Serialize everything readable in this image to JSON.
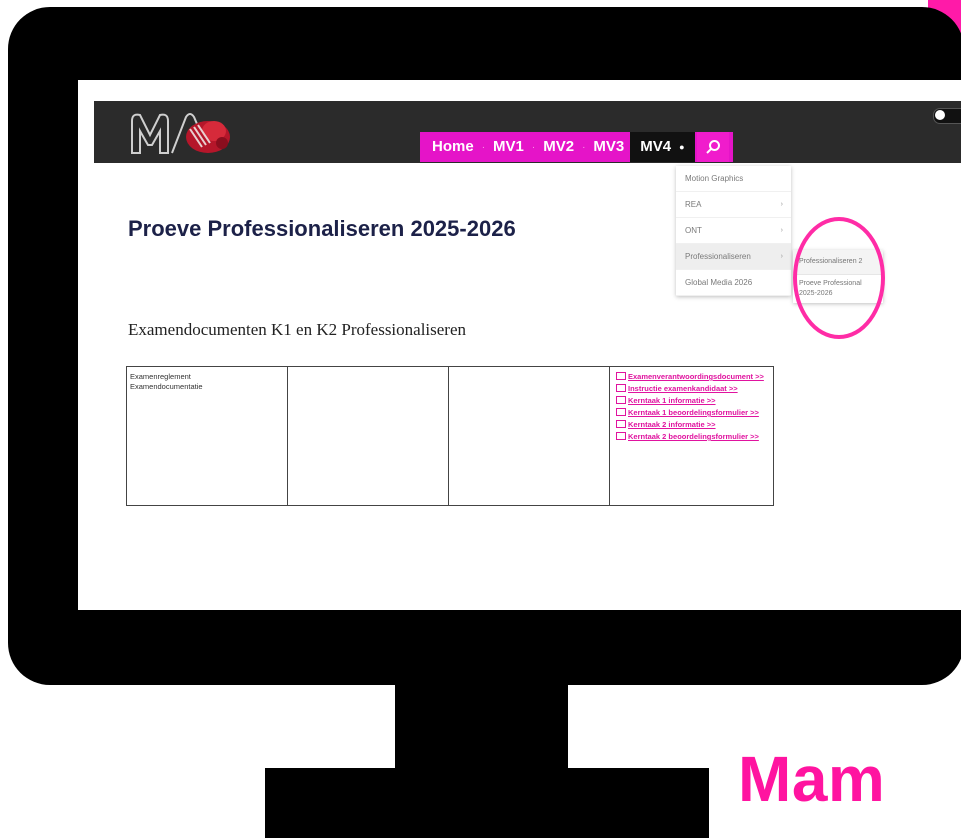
{
  "nav": {
    "items": [
      "Home",
      "MV1",
      "MV2",
      "MV3"
    ],
    "active": "MV4"
  },
  "dropdown": {
    "items": [
      "Motion Graphics",
      "REA",
      "ONT",
      "Professionaliseren",
      "Global Media 2026"
    ]
  },
  "subdropdown": {
    "items": [
      "Professionaliseren 2",
      "Proeve Professional 2025-2026"
    ]
  },
  "page": {
    "title": "Proeve Professionaliseren 2025-2026",
    "section_title": "Examendocumenten K1 en K2 Professionaliseren"
  },
  "table": {
    "col1": [
      "Examenreglement",
      "Examendocumentatie"
    ],
    "links": [
      "Examenverantwoordingsdocument >>",
      "Instructie examenkandidaat >>",
      "Kerntaak 1 informatie >>",
      "Kerntaak 1 beoordelingsformulier >>",
      "Kerntaak 2 informatie >>",
      "Kerntaak 2 beoordelingsformulier >>"
    ]
  },
  "brand": {
    "text": "Mam"
  },
  "colors": {
    "accent": "#e514c8",
    "brand_pink": "#ff14a0",
    "title_navy": "#1c2148",
    "header_bg": "#2b2b2b"
  }
}
